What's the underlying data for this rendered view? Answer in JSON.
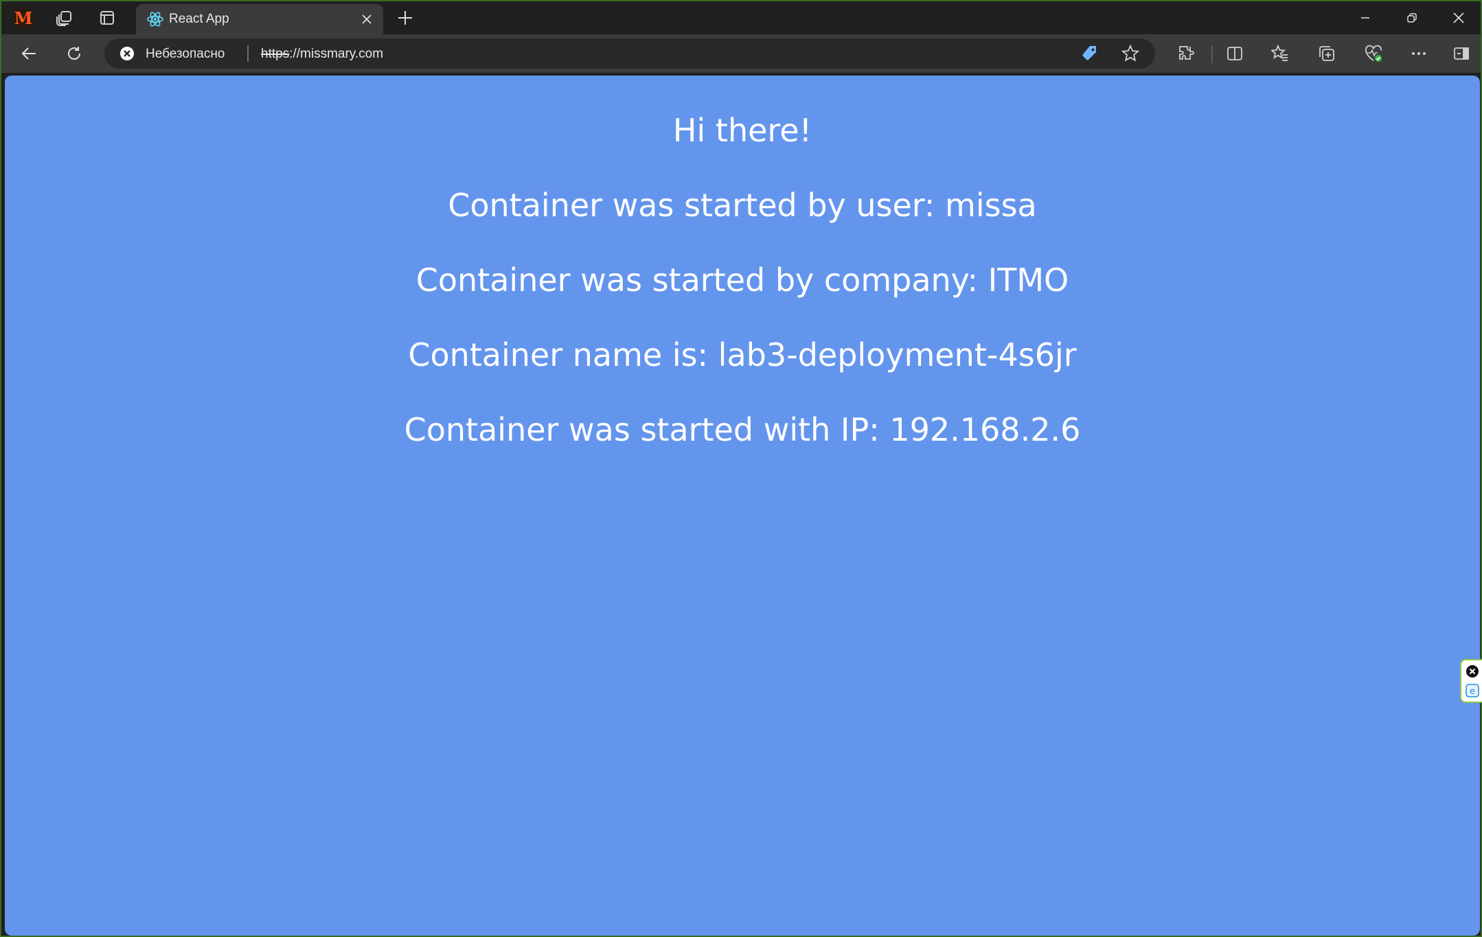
{
  "browser": {
    "tab": {
      "title": "React App",
      "favicon": "react-atom-icon"
    },
    "address_bar": {
      "security_label": "Небезопасно",
      "url_scheme": "https",
      "url_rest": "://missmary.com"
    }
  },
  "page": {
    "lines": [
      "Hi there!",
      "Container was started by user: missa",
      "Container was started by company: ITMO",
      "Container name is: lab3-deployment-4s6jr",
      "Container was started with IP: 192.168.2.6"
    ]
  },
  "colors": {
    "page_background": "#6495ed",
    "page_text": "#ffffff",
    "browser_chrome": "#202020",
    "toolbar": "#3b3b3b",
    "profile_accent": "#ff5a1f"
  },
  "icons": [
    "profile-icon",
    "workspaces-icon",
    "tab-actions-icon",
    "react-atom-icon",
    "close-icon",
    "plus-icon",
    "minimize-icon",
    "restore-icon",
    "close-window-icon",
    "back-arrow-icon",
    "reload-icon",
    "not-secure-icon",
    "coupon-icon",
    "favorite-star-icon",
    "extensions-icon",
    "split-screen-icon",
    "favorites-icon",
    "collections-icon",
    "browser-essentials-icon",
    "more-icon",
    "sidebar-icon"
  ]
}
